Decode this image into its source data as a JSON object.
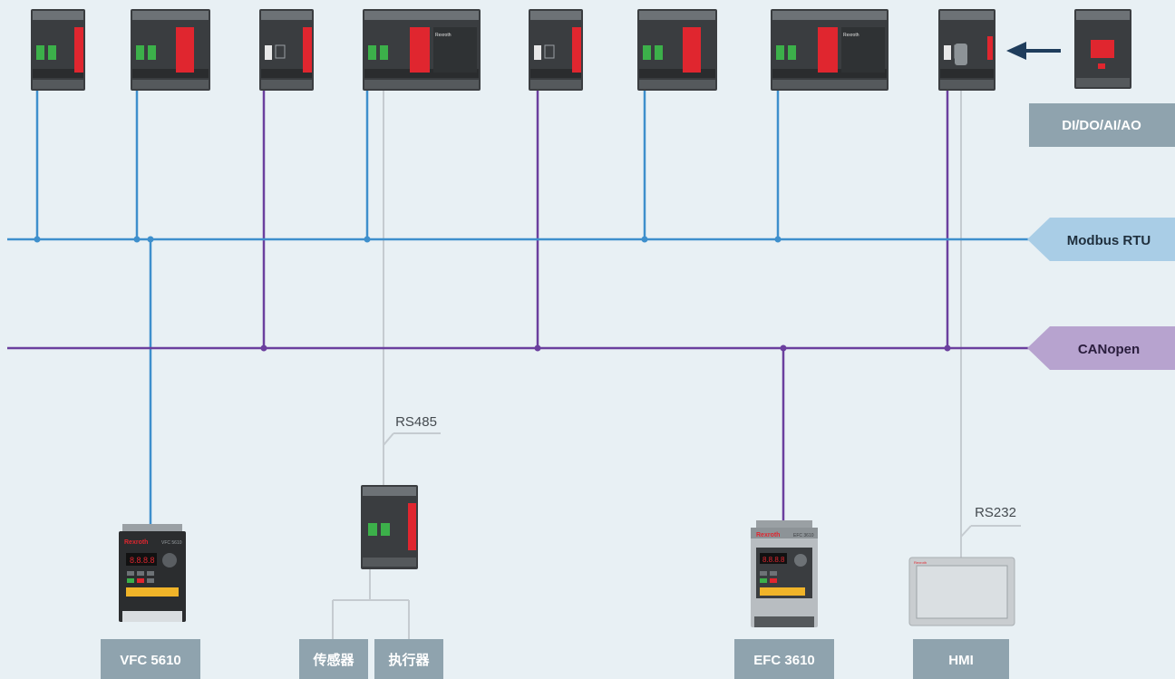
{
  "colors": {
    "background": "#e8f0f4",
    "modbus": "#3e8fcc",
    "canopen": "#6b3f9e",
    "serial": "#c5cbd0",
    "modbus_tag": "#a9cde6",
    "canopen_tag": "#b7a3cf",
    "label_bg": "#8fa3ae",
    "label_text": "#ffffff",
    "arrow": "#1f3d5c",
    "plc_body": "#3a3d40",
    "plc_red": "#e0262f"
  },
  "buses": {
    "modbus": "Modbus RTU",
    "canopen": "CANopen"
  },
  "serial_links": {
    "rs485": "RS485",
    "rs232": "RS232"
  },
  "controllers": [
    {
      "id": "plc-1",
      "variant": "small"
    },
    {
      "id": "plc-2",
      "variant": "medium"
    },
    {
      "id": "plc-3",
      "variant": "can-small"
    },
    {
      "id": "plc-4",
      "variant": "large",
      "brand": "Rexroth"
    },
    {
      "id": "plc-5",
      "variant": "can-small"
    },
    {
      "id": "plc-6",
      "variant": "medium"
    },
    {
      "id": "plc-7",
      "variant": "large",
      "brand": "Rexroth"
    },
    {
      "id": "plc-8",
      "variant": "serial"
    }
  ],
  "io_module": {
    "label": "DI/DO/AI/AO"
  },
  "devices": [
    {
      "id": "vfc",
      "label": "VFC 5610",
      "brand": "Rexroth",
      "model": "VFC 5610"
    },
    {
      "id": "sensor",
      "label": "传感器"
    },
    {
      "id": "actuator",
      "label": "执行器"
    },
    {
      "id": "efc",
      "label": "EFC 3610",
      "brand": "Rexroth",
      "model": "EFC 3610"
    },
    {
      "id": "hmi",
      "label": "HMI",
      "brand": "Rexroth"
    }
  ]
}
